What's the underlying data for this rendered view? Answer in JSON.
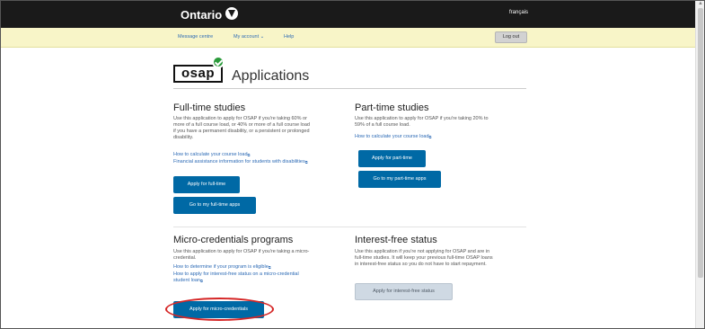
{
  "header": {
    "logo": "Ontario",
    "language": "français"
  },
  "nav": {
    "message_centre": "Message centre",
    "my_account": "My account ⌄",
    "help": "Help",
    "logout": "Log out"
  },
  "page": {
    "brand": "osap",
    "title": "Applications"
  },
  "full_time": {
    "title": "Full-time studies",
    "desc_lines": [
      "Use this application to apply for OSAP if you're taking 60% or",
      "more of a full course load, or 40% or more of a full course load",
      "if you have a permanent disability, or a persistent or prolonged",
      "disability."
    ],
    "link1": "How to calculate your course load",
    "link2": "Financial assistance information for students with disabilities",
    "apply_btn": "Apply for full-time",
    "goto_btn": "Go to my full-time apps"
  },
  "part_time": {
    "title": "Part-time studies",
    "desc_lines": [
      "Use this application to apply for OSAP if you're taking 20% to",
      "59% of a full course load."
    ],
    "link1": "How to calculate your course load",
    "apply_btn": "Apply for part-time",
    "goto_btn": "Go to my part-time apps"
  },
  "micro": {
    "title": "Micro-credentials programs",
    "desc_lines": [
      "Use this application to apply for OSAP if you're taking a micro-",
      "credential."
    ],
    "link1": "How to determine if your program is eligible",
    "link2_lines": [
      "How to apply for interest-free status on a micro-credential",
      "student loan"
    ],
    "apply_btn": "Apply for micro-credentials"
  },
  "interest_free": {
    "title": "Interest-free status",
    "desc_lines": [
      "Use this application if you're not applying for OSAP and are in",
      "full-time studies. It will keep your previous full-time OSAP loans",
      "in interest-free status so you do not have to start repayment."
    ],
    "apply_btn": "Apply for interest-free status"
  },
  "colors": {
    "primary_button": "#0069a5",
    "nav_background": "#f8f5c8",
    "header_background": "#1a1a1a",
    "highlight": "#d52626"
  }
}
